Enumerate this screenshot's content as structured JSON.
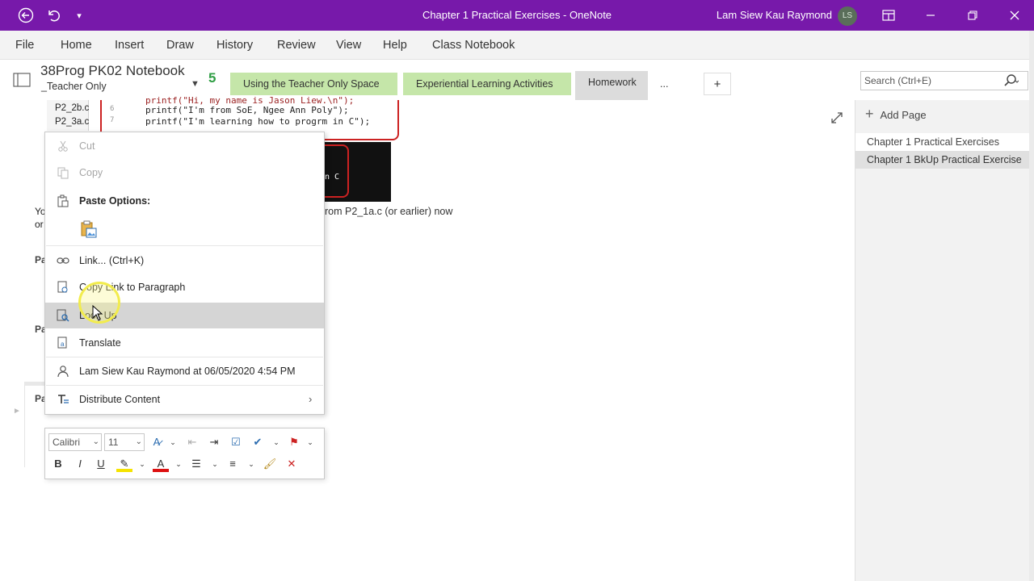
{
  "window": {
    "title": "Chapter 1 Practical Exercises  -  OneNote",
    "user_name": "Lam Siew Kau Raymond",
    "avatar_initials": "LS"
  },
  "menu": {
    "items": [
      "File",
      "Home",
      "Insert",
      "Draw",
      "History",
      "Review",
      "View",
      "Help",
      "Class Notebook"
    ]
  },
  "notebook": {
    "name": "38Prog PK02 Notebook",
    "section": "_Teacher Only",
    "sync_badge": "5"
  },
  "tabs": {
    "t1": "Using the Teacher Only Space",
    "t2": "Experiential Learning Activities",
    "t3": "Homework",
    "more": "...",
    "add": "+"
  },
  "search": {
    "placeholder": "Search (Ctrl+E)"
  },
  "pages": {
    "add_label": "Add Page",
    "items": [
      "Chapter 1 Practical Exercises",
      "Chapter 1 BkUp Practical Exercise"
    ]
  },
  "content": {
    "files": [
      "P2_2b.c",
      "P2_3a.c"
    ],
    "code_lines": [
      {
        "num": "",
        "text": "printf(\"Hi, my name is Jason Liew.\\n\");"
      },
      {
        "num": "6",
        "text": "printf(\"I'm from SoE, Ngee Ann Poly\");"
      },
      {
        "num": "7",
        "text": "printf(\"I'm learning how to progrm in C\");"
      }
    ],
    "console_snippet": "n C",
    "partial_text": "rom P2_1a.c (or earlier) now",
    "left_fragments": [
      "Yo",
      "or",
      "Pa",
      "Pa",
      "Pa"
    ]
  },
  "context_menu": {
    "cut": "Cut",
    "copy": "Copy",
    "paste_options": "Paste Options:",
    "link": "Link...  (Ctrl+K)",
    "copy_link": "Copy Link to Paragraph",
    "look_up": "Look Up",
    "translate": "Translate",
    "author": "Lam Siew Kau Raymond at 06/05/2020 4:54 PM",
    "distribute": "Distribute Content"
  },
  "mini_toolbar": {
    "font": "Calibri",
    "size": "11"
  },
  "colors": {
    "titlebar": "#7719aa",
    "tab_green": "#c5e6a9",
    "tab_active": "#dcdcdc",
    "highlight": "#d5d5d5",
    "cursor_ring": "#f2ec4d"
  }
}
